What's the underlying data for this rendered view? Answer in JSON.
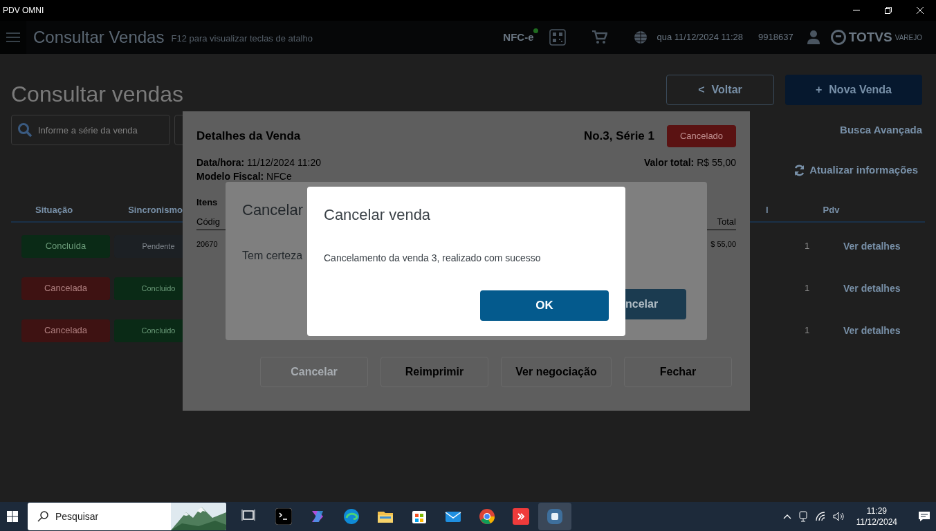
{
  "window": {
    "title": "PDV OMNI"
  },
  "header": {
    "title": "Consultar Vendas",
    "hint": "F12 para visualizar teclas de atalho",
    "nfce": {
      "label": "NFC-e",
      "color": "#1f6b1f"
    },
    "datetime": "qua 11/12/2024 11:28",
    "user_code": "9918637",
    "logo": {
      "brand": "TOTVS",
      "sub": "VAREJO"
    }
  },
  "page": {
    "title": "Consultar vendas",
    "back_button": {
      "icon": "<",
      "label": "Voltar"
    },
    "new_button": {
      "icon": "+",
      "label": "Nova Venda"
    },
    "search": {
      "placeholder": "Informe a série da venda"
    },
    "advanced_search": "Busca Avançada",
    "refresh": "Atualizar informações"
  },
  "table": {
    "columns": [
      "Situação",
      "Sincronismo",
      "l",
      "Pdv"
    ],
    "rows": [
      {
        "situation": {
          "label": "Concluída",
          "kind": "done"
        },
        "sync": {
          "label": "Pendente",
          "kind": "pending"
        },
        "pdv": "1",
        "link": "Ver detalhes"
      },
      {
        "situation": {
          "label": "Cancelada",
          "kind": "cancelled"
        },
        "sync": {
          "label": "Concluido",
          "kind": "done"
        },
        "pdv": "1",
        "link": "Ver detalhes"
      },
      {
        "situation": {
          "label": "Cancelada",
          "kind": "cancelled"
        },
        "sync": {
          "label": "Concluido",
          "kind": "done"
        },
        "pdv": "1",
        "link": "Ver detalhes"
      }
    ]
  },
  "details_modal": {
    "title": "Detalhes da Venda",
    "number": "No.3, Série 1",
    "status": "Cancelado",
    "datetime": "**Data/hora:** 11/12/2024 11:20",
    "total": "**Valor total:** R$ 55,00",
    "model": "**Modelo Fiscal:** NFCe",
    "items_label": "Itens",
    "item_columns": [
      "Códig",
      "Total"
    ],
    "item_row": [
      "20670",
      "$ 55,00"
    ],
    "buttons": [
      {
        "label": "Cancelar",
        "disabled": true
      },
      {
        "label": "Reimprimir",
        "disabled": false
      },
      {
        "label": "Ver negociação",
        "disabled": false
      },
      {
        "label": "Fechar",
        "disabled": false
      }
    ]
  },
  "confirm_modal": {
    "title": "Cancelar",
    "message": "Tem certeza",
    "button": "ncelar"
  },
  "success_modal": {
    "title": "Cancelar venda",
    "message": "Cancelamento da venda 3, realizado com sucesso",
    "button": "OK"
  },
  "taskbar": {
    "search_placeholder": "Pesquisar",
    "apps": [
      {
        "kind": "taskview",
        "selected": false
      },
      {
        "kind": "terminal",
        "selected": false
      },
      {
        "kind": "copilot",
        "selected": false
      },
      {
        "kind": "edge",
        "selected": false
      },
      {
        "kind": "folder",
        "selected": false
      },
      {
        "kind": "store",
        "selected": false
      },
      {
        "kind": "mail",
        "selected": false
      },
      {
        "kind": "chrome",
        "selected": false
      },
      {
        "kind": "anydesk",
        "selected": false
      },
      {
        "kind": "pdv",
        "selected": true
      }
    ],
    "time": "11:29",
    "date": "11/12/2024"
  }
}
